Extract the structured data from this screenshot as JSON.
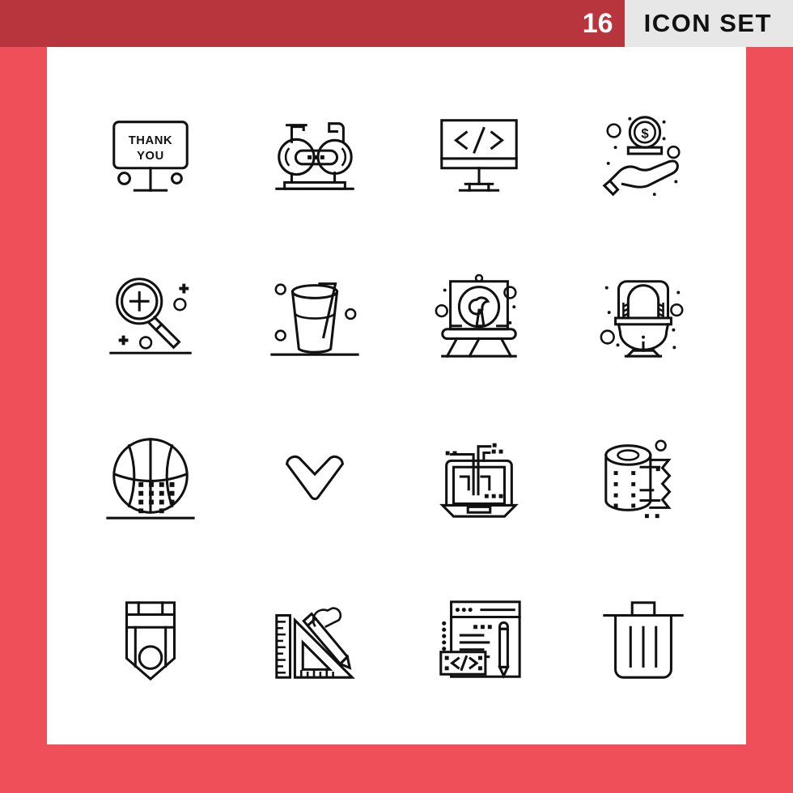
{
  "header": {
    "count": "16",
    "title": "ICON SET",
    "count_bg": "#b8353d",
    "title_bg": "#e7e7e7",
    "count_color": "#ffffff",
    "title_color": "#111111"
  },
  "frame": {
    "border_color": "#ef4f59",
    "canvas_color": "#ffffff"
  },
  "grid": {
    "columns": 4,
    "rows": 4,
    "total": 16
  },
  "icons": [
    {
      "index": 1,
      "name": "thank-you-billboard-icon",
      "label": "Thank You Billboard",
      "sign_line1": "THANK",
      "sign_line2": "YOU"
    },
    {
      "index": 2,
      "name": "exercise-bike-icon",
      "label": "Exercise Bike"
    },
    {
      "index": 3,
      "name": "code-monitor-icon",
      "label": "Code Monitor",
      "code_text": "</>"
    },
    {
      "index": 4,
      "name": "hand-holding-coin-icon",
      "label": "Hand Holding Dollar Coin",
      "coin_symbol": "$"
    },
    {
      "index": 5,
      "name": "zoom-in-magnifier-icon",
      "label": "Zoom In Magnifier"
    },
    {
      "index": 6,
      "name": "drink-glass-straw-icon",
      "label": "Drink Glass With Straw"
    },
    {
      "index": 7,
      "name": "easel-canvas-icon",
      "label": "Painting Easel"
    },
    {
      "index": 8,
      "name": "toilet-icon",
      "label": "Toilet"
    },
    {
      "index": 9,
      "name": "basketball-icon",
      "label": "Basketball"
    },
    {
      "index": 10,
      "name": "chevron-down-icon",
      "label": "Chevron Down"
    },
    {
      "index": 11,
      "name": "laptop-circuit-icon",
      "label": "Laptop Technology"
    },
    {
      "index": 12,
      "name": "toilet-paper-roll-icon",
      "label": "Toilet Paper Roll"
    },
    {
      "index": 13,
      "name": "badge-ribbon-icon",
      "label": "Award Badge"
    },
    {
      "index": 14,
      "name": "drafting-tools-icon",
      "label": "Ruler Pencil Set Square"
    },
    {
      "index": 15,
      "name": "web-development-icon",
      "label": "Web Development Window",
      "code_text": "</>"
    },
    {
      "index": 16,
      "name": "trash-can-icon",
      "label": "Trash Can"
    }
  ]
}
